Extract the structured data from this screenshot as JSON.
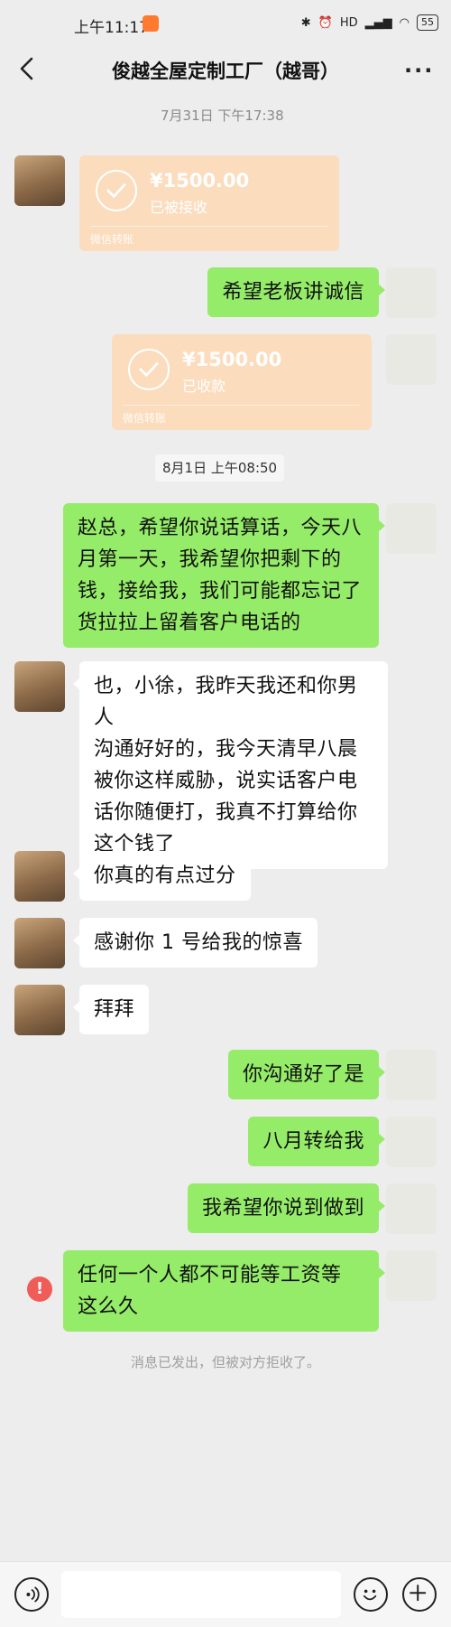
{
  "status_bar": {
    "time": "上午11:17",
    "signal": "HD",
    "battery": "55"
  },
  "header": {
    "title": "俊越全屋定制工厂（越哥）"
  },
  "timestamps": [
    "7月31日 下午17:38",
    "8月1日 上午08:50"
  ],
  "transfers": [
    {
      "amount": "¥1500.00",
      "status": "已被接收",
      "label": "微信转账"
    },
    {
      "amount": "¥1500.00",
      "status": "已收款",
      "label": "微信转账"
    }
  ],
  "messages": [
    {
      "text": "希望老板讲诚信"
    },
    {
      "lines": [
        "赵总，希望你说话算话，今天八",
        "月第一天，我希望你把剩下的",
        "钱，接给我，我们可能都忘记了",
        "货拉拉上留着客户电话的"
      ]
    },
    {
      "lines": [
        "也，小徐，我昨天我还和你男人",
        "沟通好好的，我今天清早八晨",
        "被你这样威胁，说实话客户电",
        "话你随便打，我真不打算给你",
        "这个钱了"
      ]
    },
    {
      "text": "你真的有点过分"
    },
    {
      "text": "感谢你 1 号给我的惊喜"
    },
    {
      "text": "拜拜"
    },
    {
      "text": "你沟通好了是"
    },
    {
      "text": "八月转给我"
    },
    {
      "text": "我希望你说到做到"
    },
    {
      "lines": [
        "任何一个人都不可能等工资等",
        "这么久"
      ]
    }
  ],
  "error": {
    "symbol": "!",
    "note": "消息已发出，但被对方拒收了。"
  },
  "colors": {
    "sent_bubble": "#95ec69",
    "received_bubble": "#ffffff",
    "transfer_card": "#fbdcbd",
    "error": "#f05d59"
  }
}
